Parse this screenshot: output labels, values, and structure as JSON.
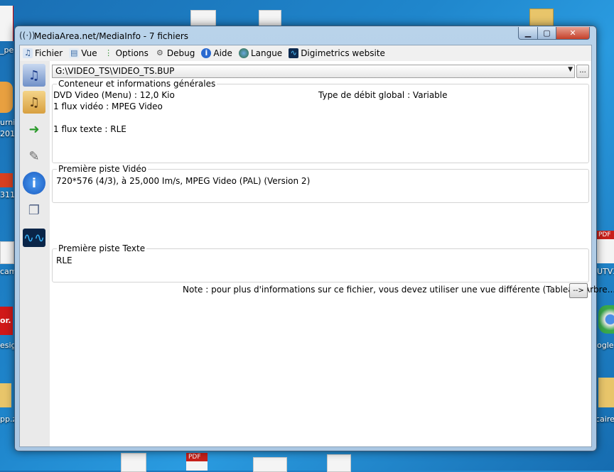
{
  "window": {
    "title": "MediaArea.net/MediaInfo - 7 fichiers",
    "min_glyph": "▁",
    "max_glyph": "▢",
    "close_glyph": "✕"
  },
  "menu": [
    {
      "label": "Fichier",
      "icon": "file-open-icon"
    },
    {
      "label": "Vue",
      "icon": "view-icon"
    },
    {
      "label": "Options",
      "icon": "options-icon"
    },
    {
      "label": "Debug",
      "icon": "debug-icon"
    },
    {
      "label": "Aide",
      "icon": "help-icon"
    },
    {
      "label": "Langue",
      "icon": "language-icon"
    },
    {
      "label": "Digimetrics website",
      "icon": "digimetrics-icon"
    }
  ],
  "sidebar": [
    {
      "icon": "open-file-icon"
    },
    {
      "icon": "open-folder-icon"
    },
    {
      "icon": "export-icon"
    },
    {
      "icon": "preferences-icon"
    },
    {
      "icon": "about-icon"
    },
    {
      "icon": "view-sheet-icon"
    },
    {
      "icon": "digimetrics-sidebar-icon"
    }
  ],
  "file": {
    "path": "G:\\VIDEO_TS\\VIDEO_TS.BUP",
    "browse_label": "..."
  },
  "general": {
    "title": "Conteneur et informations générales",
    "format": "DVD Video (Menu) : 12,0 Kio",
    "bitrate_mode": "Type de débit global : Variable",
    "video_count": "1 flux vidéo : MPEG Video",
    "text_count": "1 flux texte : RLE"
  },
  "video": {
    "title": "Première piste Vidéo",
    "details": "720*576 (4/3), à 25,000 Im/s, MPEG Video (PAL) (Version 2)"
  },
  "text": {
    "title": "Première piste Texte",
    "details": "RLE"
  },
  "note": {
    "text": "Note : pour plus d'informations sur ce fichier, vous devez utiliser une vue différente (Tableau, Arbre...)",
    "button": "-->"
  },
  "desktop_labels": {
    "l1": "_pe",
    "l2": "urni",
    "l3": "201",
    "l4": "311(",
    "l5": "cam",
    "l6": "esig",
    "l7": "pp.z",
    "r1": "PDF",
    "r2": "UTV3.",
    "r3": "ogle",
    "r4": "caire_",
    "b1": "PDF",
    "l_badge": "or."
  },
  "colors": {
    "accent": "#1a6fb4",
    "close_red": "#c4402a"
  }
}
